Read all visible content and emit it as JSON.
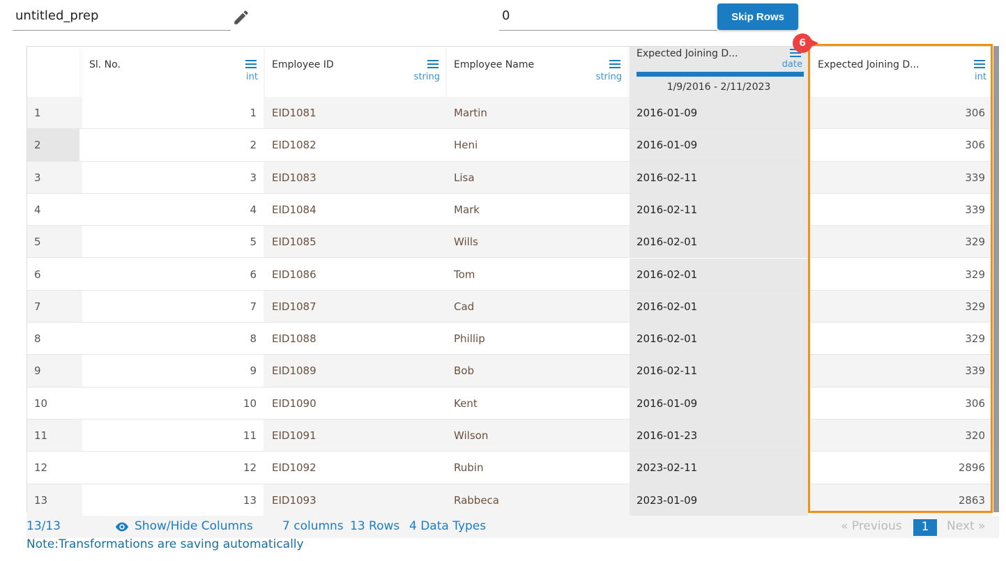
{
  "top": {
    "name": "untitled_prep",
    "skip_value": "0",
    "skip_label": "Skip Rows"
  },
  "columns": [
    {
      "label": "",
      "type": ""
    },
    {
      "label": "Sl. No.",
      "type": "int"
    },
    {
      "label": "Employee ID",
      "type": "string"
    },
    {
      "label": "Employee Name",
      "type": "string"
    },
    {
      "label": "Expected Joining D...",
      "type": "date",
      "range": "1/9/2016 - 2/11/2023"
    },
    {
      "label": "Expected Joining D...",
      "type": "int"
    }
  ],
  "rows": [
    [
      "1",
      "1",
      "EID1081",
      "Martin",
      "2016-01-09",
      "306"
    ],
    [
      "2",
      "2",
      "EID1082",
      "Heni",
      "2016-01-09",
      "306"
    ],
    [
      "3",
      "3",
      "EID1083",
      "Lisa",
      "2016-02-11",
      "339"
    ],
    [
      "4",
      "4",
      "EID1084",
      "Mark",
      "2016-02-11",
      "339"
    ],
    [
      "5",
      "5",
      "EID1085",
      "Wills",
      "2016-02-01",
      "329"
    ],
    [
      "6",
      "6",
      "EID1086",
      "Tom",
      "2016-02-01",
      "329"
    ],
    [
      "7",
      "7",
      "EID1087",
      "Cad",
      "2016-02-01",
      "329"
    ],
    [
      "8",
      "8",
      "EID1088",
      "Phillip",
      "2016-02-01",
      "329"
    ],
    [
      "9",
      "9",
      "EID1089",
      "Bob",
      "2016-02-11",
      "339"
    ],
    [
      "10",
      "10",
      "EID1090",
      "Kent",
      "2016-01-09",
      "306"
    ],
    [
      "11",
      "11",
      "EID1091",
      "Wilson",
      "2016-01-23",
      "320"
    ],
    [
      "12",
      "12",
      "EID1092",
      "Rubin",
      "2023-02-11",
      "2896"
    ],
    [
      "13",
      "13",
      "EID1093",
      "Rabbeca",
      "2023-01-09",
      "2863"
    ]
  ],
  "badge": "6",
  "footer": {
    "count": "13/13",
    "show_hide": "Show/Hide Columns",
    "columns": "7 columns",
    "rows": "13 Rows",
    "types": "4 Data Types",
    "prev": "« Previous",
    "page": "1",
    "next": "Next »"
  },
  "note": "Note:Transformations are saving automatically",
  "colors": {
    "accent": "#1a7dc4",
    "highlight": "#f29111",
    "badge": "#ee4040"
  }
}
